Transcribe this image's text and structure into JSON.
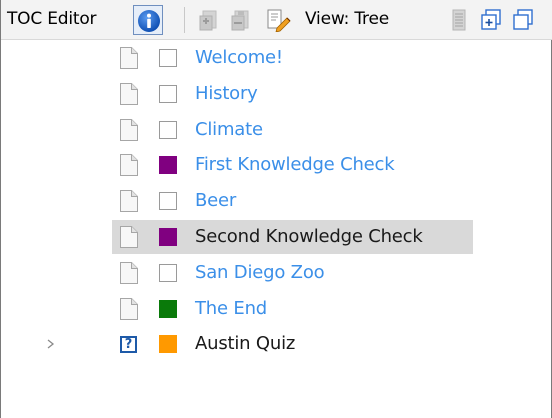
{
  "toolbar": {
    "title": "TOC Editor",
    "view_label": "View: Tree"
  },
  "icons": {
    "info": "info-icon",
    "grayed_1": "add-page-icon",
    "grayed_2": "remove-page-icon",
    "view": "edit-document-icon",
    "list": "list-icon",
    "copy_1": "add-copy-icon",
    "copy_2": "copy-icon",
    "expander": "chevron-right-icon",
    "page": "page-icon"
  },
  "colors": {
    "link": "#3b8fe8",
    "accent": "#1e5aa8",
    "purple": "#800080",
    "green": "#0a7a0a",
    "orange": "#ff9900"
  },
  "tree": {
    "items": [
      {
        "label": "Welcome!",
        "kind": "page",
        "swatch": null,
        "style": "link"
      },
      {
        "label": "History",
        "kind": "page",
        "swatch": null,
        "style": "link"
      },
      {
        "label": "Climate",
        "kind": "page",
        "swatch": null,
        "style": "link"
      },
      {
        "label": "First Knowledge Check",
        "kind": "page",
        "swatch": "#800080",
        "style": "link"
      },
      {
        "label": "Beer",
        "kind": "page",
        "swatch": null,
        "style": "link"
      },
      {
        "label": "Second Knowledge Check",
        "kind": "page",
        "swatch": "#800080",
        "style": "plain",
        "selected": true
      },
      {
        "label": "San Diego Zoo",
        "kind": "page",
        "swatch": null,
        "style": "link"
      },
      {
        "label": "The End",
        "kind": "page",
        "swatch": "#0a7a0a",
        "style": "link"
      },
      {
        "label": "Austin Quiz",
        "kind": "quiz",
        "quiz_mark": "?",
        "swatch": "#ff9900",
        "style": "plain",
        "expandable": true
      }
    ]
  }
}
